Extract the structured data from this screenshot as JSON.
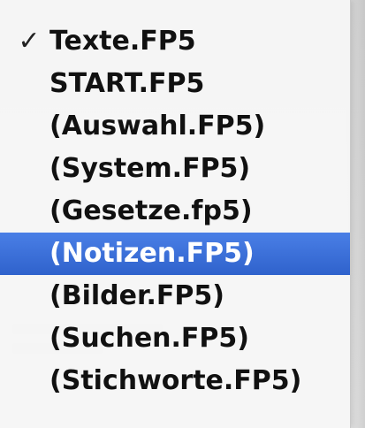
{
  "menu": {
    "items": [
      {
        "label": "Texte.FP5",
        "checked": true,
        "highlighted": false
      },
      {
        "label": "START.FP5",
        "checked": false,
        "highlighted": false
      },
      {
        "label": "(Auswahl.FP5)",
        "checked": false,
        "highlighted": false
      },
      {
        "label": "(System.FP5)",
        "checked": false,
        "highlighted": false
      },
      {
        "label": "(Gesetze.fp5)",
        "checked": false,
        "highlighted": false
      },
      {
        "label": "(Notizen.FP5)",
        "checked": false,
        "highlighted": true
      },
      {
        "label": "(Bilder.FP5)",
        "checked": false,
        "highlighted": false
      },
      {
        "label": "(Suchen.FP5)",
        "checked": false,
        "highlighted": false
      },
      {
        "label": "(Stichworte.FP5)",
        "checked": false,
        "highlighted": false
      }
    ],
    "checkmark_glyph": "✓",
    "highlight_color": "#3b6fd8",
    "text_color": "#111111"
  }
}
